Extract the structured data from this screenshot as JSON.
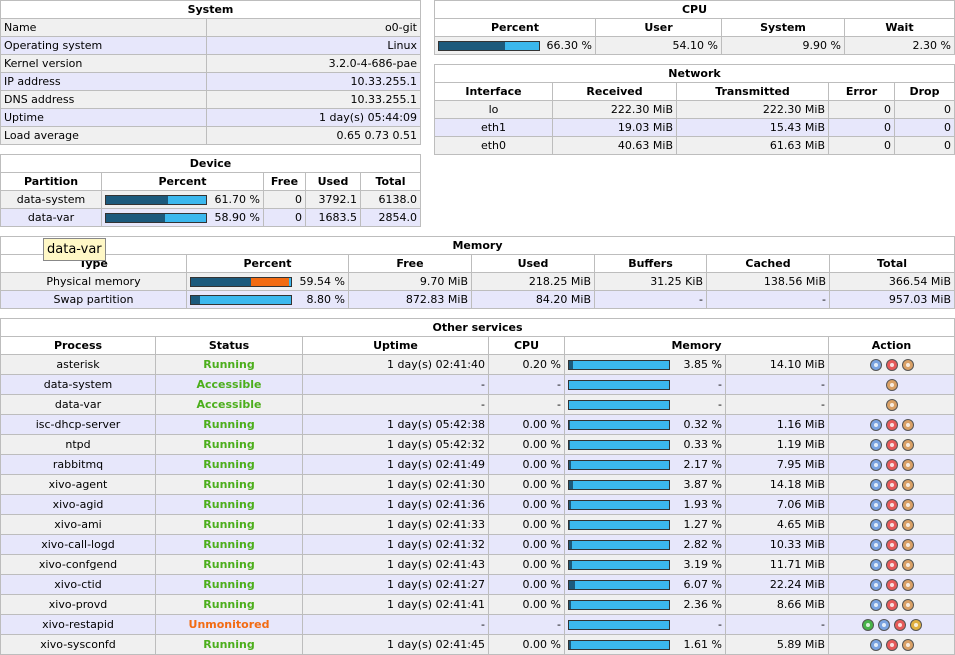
{
  "system": {
    "title": "System",
    "rows": [
      {
        "label": "Name",
        "value": "o0-git"
      },
      {
        "label": "Operating system",
        "value": "Linux"
      },
      {
        "label": "Kernel version",
        "value": "3.2.0-4-686-pae"
      },
      {
        "label": "IP address",
        "value": "10.33.255.1"
      },
      {
        "label": "DNS address",
        "value": "10.33.255.1"
      },
      {
        "label": "Uptime",
        "value": "1 day(s) 05:44:09"
      },
      {
        "label": "Load average",
        "value": "0.65 0.73 0.51"
      }
    ]
  },
  "cpu": {
    "title": "CPU",
    "headers": [
      "Percent",
      "User",
      "System",
      "Wait"
    ],
    "percent": "66.30 %",
    "percent_value": 0.663,
    "user": "54.10 %",
    "system": "9.90 %",
    "wait": "2.30 %"
  },
  "network": {
    "title": "Network",
    "headers": [
      "Interface",
      "Received",
      "Transmitted",
      "Error",
      "Drop"
    ],
    "rows": [
      {
        "iface": "lo",
        "rx": "222.30 MiB",
        "tx": "222.30 MiB",
        "err": "0",
        "drop": "0"
      },
      {
        "iface": "eth1",
        "rx": "19.03 MiB",
        "tx": "15.43 MiB",
        "err": "0",
        "drop": "0"
      },
      {
        "iface": "eth0",
        "rx": "40.63 MiB",
        "tx": "61.63 MiB",
        "err": "0",
        "drop": "0"
      }
    ]
  },
  "device": {
    "title": "Device",
    "headers": [
      "Partition",
      "Percent",
      "Free",
      "Used",
      "Total"
    ],
    "rows": [
      {
        "partition": "data-system",
        "percent": "61.70 %",
        "percent_value": 0.617,
        "free": "0",
        "used": "3792.1",
        "total": "6138.0"
      },
      {
        "partition": "data-var",
        "percent": "58.90 %",
        "percent_value": 0.589,
        "free": "0",
        "used": "1683.5",
        "total": "2854.0"
      }
    ]
  },
  "tooltip": "data-var",
  "memory": {
    "title": "Memory",
    "headers": [
      "Type",
      "Percent",
      "Free",
      "Used",
      "Buffers",
      "Cached",
      "Total"
    ],
    "rows": [
      {
        "type": "Physical memory",
        "percent": "59.54 %",
        "used_value": 0.6,
        "cached_value": 0.38,
        "free": "9.70 MiB",
        "used": "218.25 MiB",
        "buffers": "31.25 KiB",
        "cached": "138.56 MiB",
        "total": "366.54 MiB"
      },
      {
        "type": "Swap partition",
        "percent": "8.80 %",
        "used_value": 0.088,
        "cached_value": 0,
        "free": "872.83 MiB",
        "used": "84.20 MiB",
        "buffers": "-",
        "cached": "-",
        "total": "957.03 MiB"
      }
    ]
  },
  "services": {
    "title": "Other services",
    "headers": [
      "Process",
      "Status",
      "Uptime",
      "CPU",
      "Memory",
      "Action"
    ],
    "rows": [
      {
        "process": "asterisk",
        "status": "Running",
        "status_kind": "ok",
        "uptime": "1 day(s) 02:41:40",
        "cpu": "0.20 %",
        "mem_pct": "3.85 %",
        "mem_value": 0.0385,
        "mem": "14.10 MiB",
        "actions": [
          "monitor-icon",
          "stop-icon",
          "restart-icon"
        ]
      },
      {
        "process": "data-system",
        "status": "Accessible",
        "status_kind": "ok",
        "uptime": "-",
        "cpu": "-",
        "mem_pct": "-",
        "mem_value": 0,
        "mem": "-",
        "actions": [
          "restart-icon"
        ]
      },
      {
        "process": "data-var",
        "status": "Accessible",
        "status_kind": "ok",
        "uptime": "-",
        "cpu": "-",
        "mem_pct": "-",
        "mem_value": 0,
        "mem": "-",
        "actions": [
          "restart-icon"
        ]
      },
      {
        "process": "isc-dhcp-server",
        "status": "Running",
        "status_kind": "ok",
        "uptime": "1 day(s) 05:42:38",
        "cpu": "0.00 %",
        "mem_pct": "0.32 %",
        "mem_value": 0.0032,
        "mem": "1.16 MiB",
        "actions": [
          "monitor-icon",
          "stop-icon",
          "restart-icon"
        ]
      },
      {
        "process": "ntpd",
        "status": "Running",
        "status_kind": "ok",
        "uptime": "1 day(s) 05:42:32",
        "cpu": "0.00 %",
        "mem_pct": "0.33 %",
        "mem_value": 0.0033,
        "mem": "1.19 MiB",
        "actions": [
          "monitor-icon",
          "stop-icon",
          "restart-icon"
        ]
      },
      {
        "process": "rabbitmq",
        "status": "Running",
        "status_kind": "ok",
        "uptime": "1 day(s) 02:41:49",
        "cpu": "0.00 %",
        "mem_pct": "2.17 %",
        "mem_value": 0.0217,
        "mem": "7.95 MiB",
        "actions": [
          "monitor-icon",
          "stop-icon",
          "restart-icon"
        ]
      },
      {
        "process": "xivo-agent",
        "status": "Running",
        "status_kind": "ok",
        "uptime": "1 day(s) 02:41:30",
        "cpu": "0.00 %",
        "mem_pct": "3.87 %",
        "mem_value": 0.0387,
        "mem": "14.18 MiB",
        "actions": [
          "monitor-icon",
          "stop-icon",
          "restart-icon"
        ]
      },
      {
        "process": "xivo-agid",
        "status": "Running",
        "status_kind": "ok",
        "uptime": "1 day(s) 02:41:36",
        "cpu": "0.00 %",
        "mem_pct": "1.93 %",
        "mem_value": 0.0193,
        "mem": "7.06 MiB",
        "actions": [
          "monitor-icon",
          "stop-icon",
          "restart-icon"
        ]
      },
      {
        "process": "xivo-ami",
        "status": "Running",
        "status_kind": "ok",
        "uptime": "1 day(s) 02:41:33",
        "cpu": "0.00 %",
        "mem_pct": "1.27 %",
        "mem_value": 0.0127,
        "mem": "4.65 MiB",
        "actions": [
          "monitor-icon",
          "stop-icon",
          "restart-icon"
        ]
      },
      {
        "process": "xivo-call-logd",
        "status": "Running",
        "status_kind": "ok",
        "uptime": "1 day(s) 02:41:32",
        "cpu": "0.00 %",
        "mem_pct": "2.82 %",
        "mem_value": 0.0282,
        "mem": "10.33 MiB",
        "actions": [
          "monitor-icon",
          "stop-icon",
          "restart-icon"
        ]
      },
      {
        "process": "xivo-confgend",
        "status": "Running",
        "status_kind": "ok",
        "uptime": "1 day(s) 02:41:43",
        "cpu": "0.00 %",
        "mem_pct": "3.19 %",
        "mem_value": 0.0319,
        "mem": "11.71 MiB",
        "actions": [
          "monitor-icon",
          "stop-icon",
          "restart-icon"
        ]
      },
      {
        "process": "xivo-ctid",
        "status": "Running",
        "status_kind": "ok",
        "uptime": "1 day(s) 02:41:27",
        "cpu": "0.00 %",
        "mem_pct": "6.07 %",
        "mem_value": 0.0607,
        "mem": "22.24 MiB",
        "actions": [
          "monitor-icon",
          "stop-icon",
          "restart-icon"
        ]
      },
      {
        "process": "xivo-provd",
        "status": "Running",
        "status_kind": "ok",
        "uptime": "1 day(s) 02:41:41",
        "cpu": "0.00 %",
        "mem_pct": "2.36 %",
        "mem_value": 0.0236,
        "mem": "8.66 MiB",
        "actions": [
          "monitor-icon",
          "stop-icon",
          "restart-icon"
        ]
      },
      {
        "process": "xivo-restapid",
        "status": "Unmonitored",
        "status_kind": "bad",
        "uptime": "-",
        "cpu": "-",
        "mem_pct": "-",
        "mem_value": 0,
        "mem": "-",
        "actions": [
          "start-icon",
          "monitor-icon",
          "stop-icon",
          "unmonitor-icon"
        ]
      },
      {
        "process": "xivo-sysconfd",
        "status": "Running",
        "status_kind": "ok",
        "uptime": "1 day(s) 02:41:45",
        "cpu": "0.00 %",
        "mem_pct": "1.61 %",
        "mem_value": 0.0161,
        "mem": "5.89 MiB",
        "actions": [
          "monitor-icon",
          "stop-icon",
          "restart-icon"
        ]
      }
    ]
  }
}
